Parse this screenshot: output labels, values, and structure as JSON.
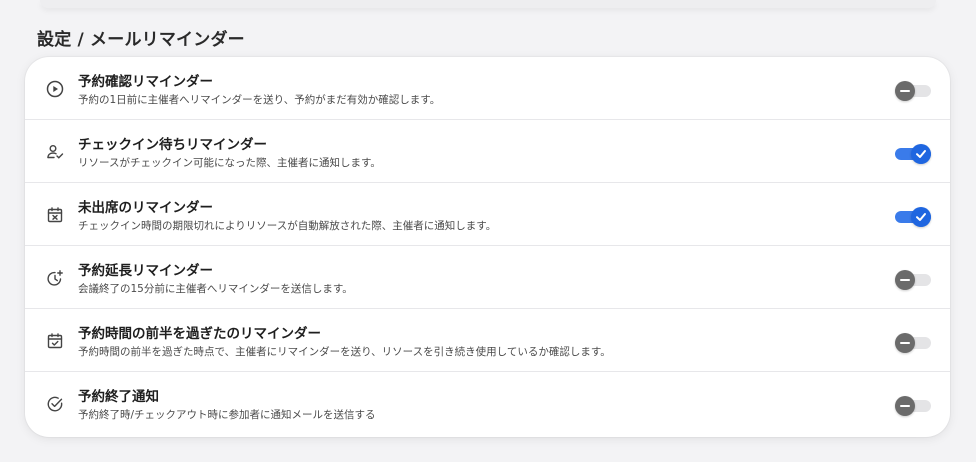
{
  "page": {
    "title": "設定 / メールリマインダー"
  },
  "colors": {
    "accent": "#1f66e0",
    "toggle_off": "#6b6b6b",
    "track_off": "#e4e4e6",
    "background": "#f3f3f5"
  },
  "reminders": [
    {
      "icon": "play-circle-icon",
      "title": "予約確認リマインダー",
      "description": "予約の1日前に主催者へリマインダーを送り、予約がまだ有効か確認します。",
      "enabled": false
    },
    {
      "icon": "user-check-icon",
      "title": "チェックイン待ちリマインダー",
      "description": "リソースがチェックイン可能になった際、主催者に通知します。",
      "enabled": true
    },
    {
      "icon": "calendar-x-icon",
      "title": "未出席のリマインダー",
      "description": "チェックイン時間の期限切れによりリソースが自動解放された際、主催者に通知します。",
      "enabled": true
    },
    {
      "icon": "clock-plus-icon",
      "title": "予約延長リマインダー",
      "description": "会議終了の15分前に主催者へリマインダーを送信します。",
      "enabled": false
    },
    {
      "icon": "calendar-check-icon",
      "title": "予約時間の前半を過ぎたのリマインダー",
      "description": "予約時間の前半を過ぎた時点で、主催者にリマインダーを送り、リソースを引き続き使用しているか確認します。",
      "enabled": false
    },
    {
      "icon": "circle-check-icon",
      "title": "予約終了通知",
      "description": "予約終了時/チェックアウト時に参加者に通知メールを送信する",
      "enabled": false
    }
  ]
}
